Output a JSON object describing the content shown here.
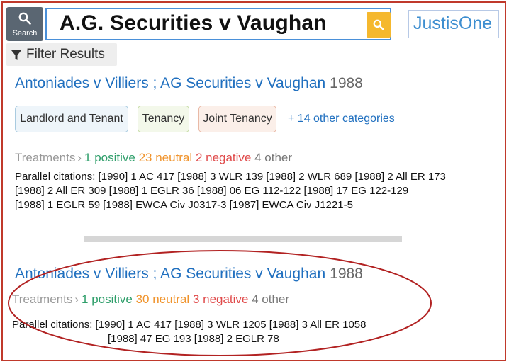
{
  "search": {
    "button_label": "Search",
    "query": "A.G. Securities v Vaughan"
  },
  "logo": {
    "text": "JustisOne"
  },
  "filter": {
    "label": "Filter Results"
  },
  "results": [
    {
      "title": "Antoniades v Villiers ; AG Securities v Vaughan",
      "year": "1988",
      "categories": [
        "Landlord and Tenant",
        "Tenancy",
        "Joint Tenancy"
      ],
      "more_categories": "+ 14 other categories",
      "treatments": {
        "label": "Treatments",
        "positive": "1 positive",
        "neutral": "23 neutral",
        "negative": "2 negative",
        "other": "4 other"
      },
      "citations": [
        "Parallel citations: [1990] 1 AC 417 [1988] 3 WLR 139 [1988] 2 WLR 689 [1988] 2 All ER 173",
        "[1988] 2 All ER 309 [1988] 1 EGLR 36 [1988] 06 EG 112-122 [1988] 17 EG 122-129",
        "[1988] 1 EGLR 59 [1988] EWCA Civ J0317-3 [1987] EWCA Civ J1221-5"
      ]
    },
    {
      "title": "Antoniades v Villiers ; AG Securities v Vaughan",
      "year": "1988",
      "treatments": {
        "label": "Treatments",
        "positive": "1 positive",
        "neutral": "30 neutral",
        "negative": "3 negative",
        "other": "4 other"
      },
      "citations": [
        "Parallel citations: [1990] 1 AC 417 [1988] 3 WLR 1205 [1988] 3 All ER 1058",
        "[1988] 47 EG 193 [1988] 2 EGLR 78"
      ]
    }
  ],
  "colors": {
    "link": "#1f6fbf",
    "positive": "#2e9e6a",
    "neutral": "#f0932b",
    "negative": "#e04b4b",
    "highlight": "#b22222",
    "search_go": "#f5b82e"
  }
}
